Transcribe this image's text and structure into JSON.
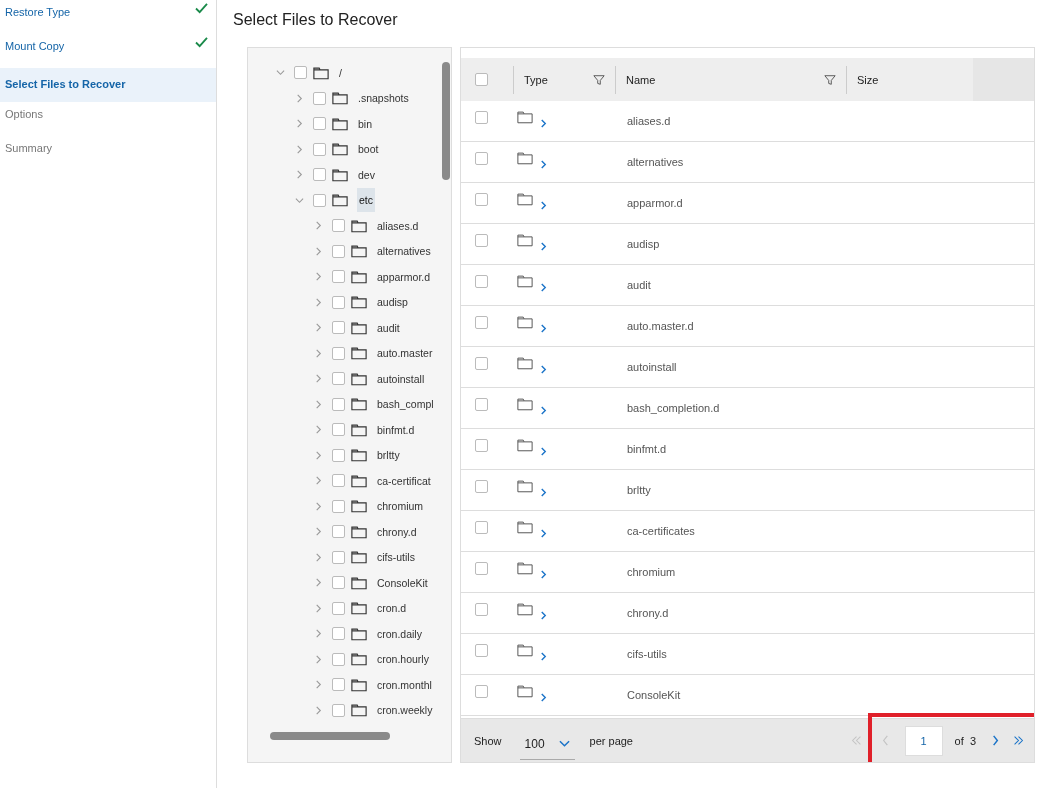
{
  "steps": [
    {
      "label": "Restore Type",
      "done": true,
      "disabled": false,
      "selected": false
    },
    {
      "label": "Mount Copy",
      "done": true,
      "disabled": false,
      "selected": false
    },
    {
      "label": "Select Files to Recover",
      "done": false,
      "disabled": false,
      "selected": true
    },
    {
      "label": "Options",
      "done": false,
      "disabled": true,
      "selected": false
    },
    {
      "label": "Summary",
      "done": false,
      "disabled": true,
      "selected": false
    }
  ],
  "title": "Select Files to Recover",
  "tree": [
    {
      "name": "/",
      "expanded": true,
      "checked": false,
      "selected": false,
      "children": [
        {
          "name": ".snapshots",
          "expanded": false,
          "checked": false,
          "selected": false
        },
        {
          "name": "bin",
          "expanded": false,
          "checked": false,
          "selected": false
        },
        {
          "name": "boot",
          "expanded": false,
          "checked": false,
          "selected": false
        },
        {
          "name": "dev",
          "expanded": false,
          "checked": false,
          "selected": false
        },
        {
          "name": "etc",
          "expanded": true,
          "checked": false,
          "selected": true,
          "children": [
            {
              "name": "aliases.d",
              "expanded": false,
              "checked": false,
              "selected": false
            },
            {
              "name": "alternatives",
              "expanded": false,
              "checked": false,
              "selected": false
            },
            {
              "name": "apparmor.d",
              "expanded": false,
              "checked": false,
              "selected": false
            },
            {
              "name": "audisp",
              "expanded": false,
              "checked": false,
              "selected": false
            },
            {
              "name": "audit",
              "expanded": false,
              "checked": false,
              "selected": false
            },
            {
              "name": "auto.master",
              "expanded": false,
              "checked": false,
              "selected": false
            },
            {
              "name": "autoinstall",
              "expanded": false,
              "checked": false,
              "selected": false
            },
            {
              "name": "bash_compl",
              "expanded": false,
              "checked": false,
              "selected": false
            },
            {
              "name": "binfmt.d",
              "expanded": false,
              "checked": false,
              "selected": false
            },
            {
              "name": "brltty",
              "expanded": false,
              "checked": false,
              "selected": false
            },
            {
              "name": "ca-certificat",
              "expanded": false,
              "checked": false,
              "selected": false
            },
            {
              "name": "chromium",
              "expanded": false,
              "checked": false,
              "selected": false
            },
            {
              "name": "chrony.d",
              "expanded": false,
              "checked": false,
              "selected": false
            },
            {
              "name": "cifs-utils",
              "expanded": false,
              "checked": false,
              "selected": false
            },
            {
              "name": "ConsoleKit",
              "expanded": false,
              "checked": false,
              "selected": false
            },
            {
              "name": "cron.d",
              "expanded": false,
              "checked": false,
              "selected": false
            },
            {
              "name": "cron.daily",
              "expanded": false,
              "checked": false,
              "selected": false
            },
            {
              "name": "cron.hourly",
              "expanded": false,
              "checked": false,
              "selected": false
            },
            {
              "name": "cron.monthl",
              "expanded": false,
              "checked": false,
              "selected": false
            },
            {
              "name": "cron.weekly",
              "expanded": false,
              "checked": false,
              "selected": false
            }
          ]
        }
      ]
    }
  ],
  "table": {
    "columns": [
      {
        "label": "Type",
        "filter": true
      },
      {
        "label": "Name",
        "filter": true
      },
      {
        "label": "Size",
        "filter": false
      }
    ],
    "all_checked": false,
    "rows": [
      {
        "name": "aliases.d",
        "checked": false
      },
      {
        "name": "alternatives",
        "checked": false
      },
      {
        "name": "apparmor.d",
        "checked": false
      },
      {
        "name": "audisp",
        "checked": false
      },
      {
        "name": "audit",
        "checked": false
      },
      {
        "name": "auto.master.d",
        "checked": false
      },
      {
        "name": "autoinstall",
        "checked": false
      },
      {
        "name": "bash_completion.d",
        "checked": false
      },
      {
        "name": "binfmt.d",
        "checked": false
      },
      {
        "name": "brltty",
        "checked": false
      },
      {
        "name": "ca-certificates",
        "checked": false
      },
      {
        "name": "chromium",
        "checked": false
      },
      {
        "name": "chrony.d",
        "checked": false
      },
      {
        "name": "cifs-utils",
        "checked": false
      },
      {
        "name": "ConsoleKit",
        "checked": false
      }
    ]
  },
  "pager": {
    "show": "Show",
    "per_page": "100",
    "per_page_label": "per page",
    "page": "1",
    "of": "of",
    "total": "3",
    "first_disabled": true,
    "prev_disabled": true,
    "next_disabled": false,
    "last_disabled": false,
    "highlighted": true
  }
}
